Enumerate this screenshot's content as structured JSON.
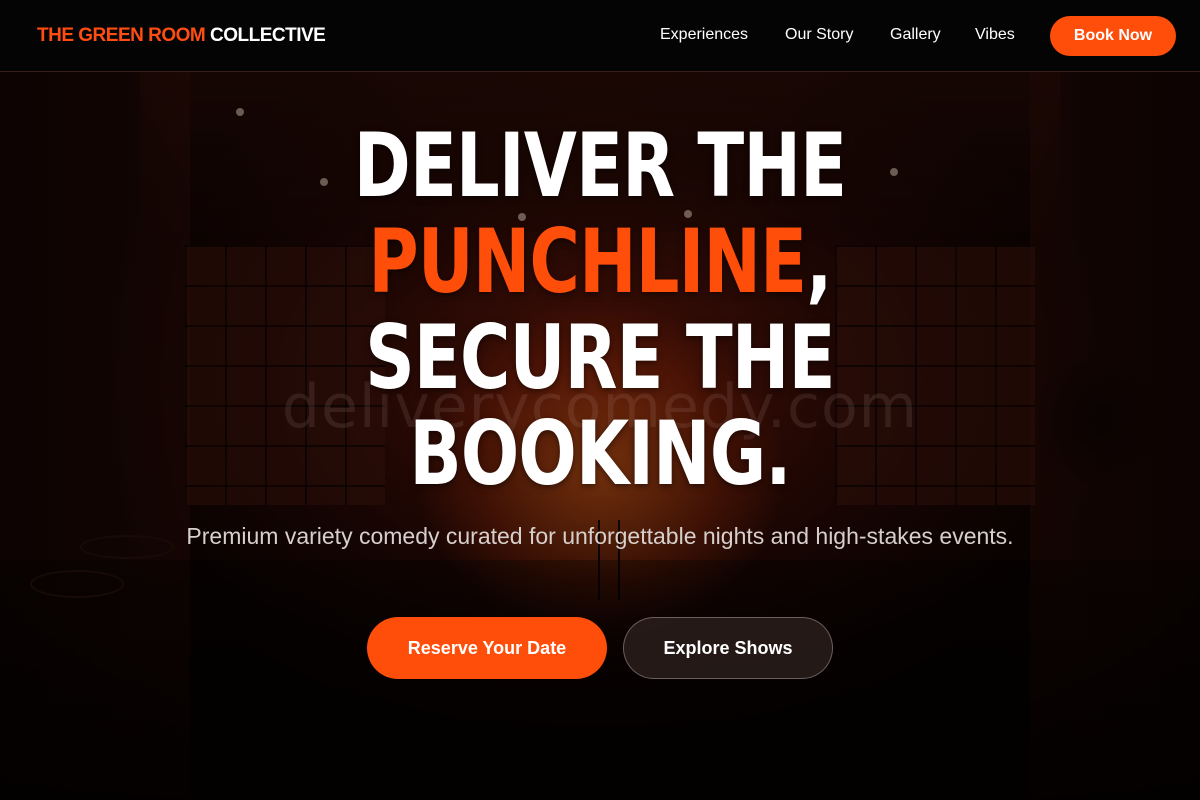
{
  "header": {
    "logo_accent": "THE GREEN ROOM",
    "logo_rest": "COLLECTIVE",
    "nav": [
      {
        "label": "Experiences"
      },
      {
        "label": "Our Story"
      },
      {
        "label": "Gallery"
      },
      {
        "label": "Vibes"
      }
    ],
    "cta_label": "Book Now"
  },
  "hero": {
    "title_line1": "DELIVER THE",
    "title_line2_accent": "PUNCHLINE",
    "title_line2_punct": ",",
    "title_line3": "SECURE THE",
    "title_line4": "BOOKING.",
    "subtitle": "Premium variety comedy curated for unforgettable nights and high-stakes events.",
    "primary_cta": "Reserve Your Date",
    "secondary_cta": "Explore Shows",
    "watermark": "deliverycomedy.com"
  },
  "colors": {
    "accent": "#ff4d0a",
    "header_bg": "#050404",
    "text": "#ffffff"
  }
}
